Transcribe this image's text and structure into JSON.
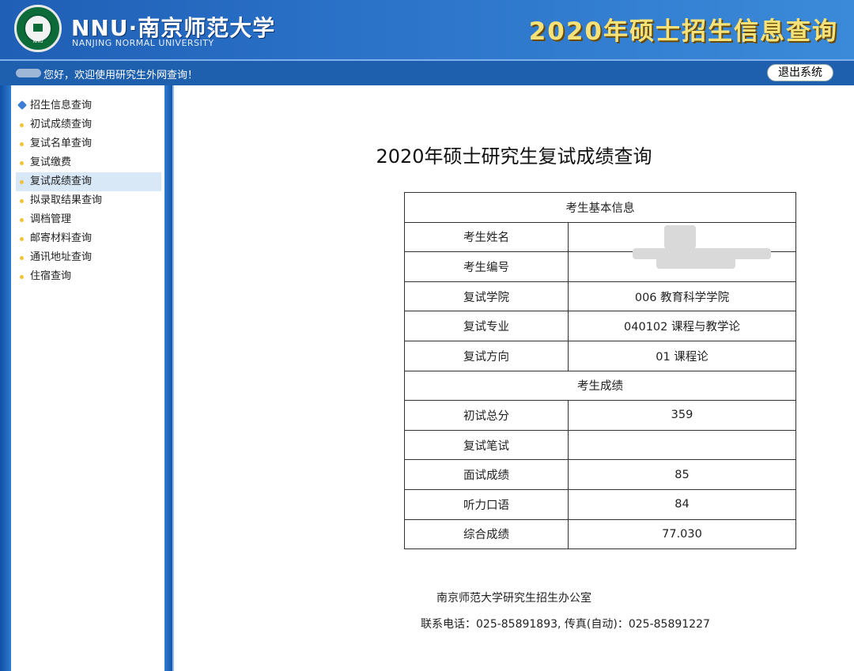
{
  "header": {
    "brand_main": "NNU·南京师范大学",
    "brand_sub": "NANJING NORMAL UNIVERSITY",
    "seal_text": "NNU",
    "title": "2020年硕士招生信息查询"
  },
  "welcome": {
    "greeting": "您好，欢迎使用研究生外网查询！",
    "logout_label": "退出系统"
  },
  "sidebar": {
    "items": [
      {
        "label": "招生信息查询",
        "icon": "cube-icon"
      },
      {
        "label": "初试成绩查询",
        "icon": "bullet-icon"
      },
      {
        "label": "复试名单查询",
        "icon": "bullet-icon"
      },
      {
        "label": "复试缴费",
        "icon": "bullet-icon"
      },
      {
        "label": "复试成绩查询",
        "icon": "bullet-icon",
        "active": true
      },
      {
        "label": "拟录取结果查询",
        "icon": "bullet-icon"
      },
      {
        "label": "调档管理",
        "icon": "bullet-icon"
      },
      {
        "label": "邮寄材料查询",
        "icon": "bullet-icon"
      },
      {
        "label": "通讯地址查询",
        "icon": "bullet-icon"
      },
      {
        "label": "住宿查询",
        "icon": "bullet-icon"
      }
    ]
  },
  "main": {
    "title": "2020年硕士研究生复试成绩查询",
    "section_basic": "考生基本信息",
    "basic_rows": [
      {
        "label": "考生姓名",
        "value": ""
      },
      {
        "label": "考生编号",
        "value": ""
      },
      {
        "label": "复试学院",
        "value": "006 教育科学学院"
      },
      {
        "label": "复试专业",
        "value": "040102 课程与教学论"
      },
      {
        "label": "复试方向",
        "value": "01 课程论"
      }
    ],
    "section_scores": "考生成绩",
    "score_rows": [
      {
        "label": "初试总分",
        "value": "359"
      },
      {
        "label": "复试笔试",
        "value": ""
      },
      {
        "label": "面试成绩",
        "value": "85"
      },
      {
        "label": "听力口语",
        "value": "84"
      },
      {
        "label": "综合成绩",
        "value": "77.030"
      }
    ]
  },
  "footer": {
    "office": "南京师范大学研究生招生办公室",
    "contact": "联系电话：025-85891893, 传真(自动)：025-85891227"
  }
}
